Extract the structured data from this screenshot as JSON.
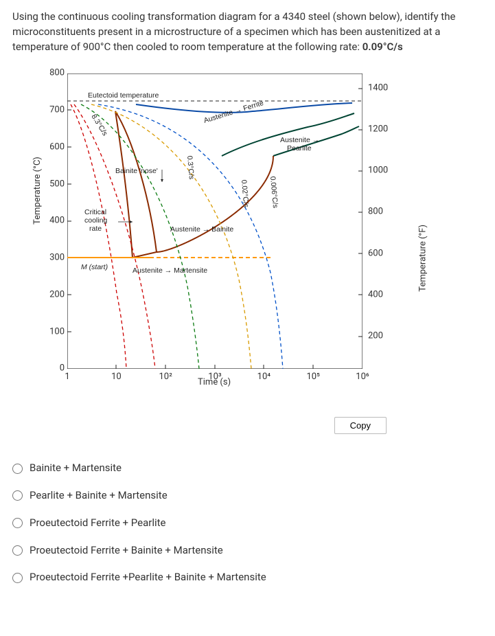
{
  "question": {
    "prefix": "Using the continuous cooling transformation diagram for a 4340 steel (shown below), identify the microconstituents present in a microstructure of a specimen which has been austenitized at a temperature of 900°C then cooled to room temperature at the following rate: ",
    "rate": "0.09°C/s"
  },
  "chart_data": {
    "type": "cct-diagram",
    "material": "4340 steel",
    "x_axis": {
      "label": "Time (s)",
      "scale": "log",
      "ticks": [
        "1",
        "10",
        "10²",
        "10³",
        "10⁴",
        "10⁵",
        "10⁶"
      ]
    },
    "y_axis_left": {
      "label": "Temperature (°C)",
      "min": 0,
      "max": 800,
      "ticks": [
        0,
        100,
        200,
        300,
        400,
        500,
        600,
        700,
        800
      ]
    },
    "y_axis_right": {
      "label": "Temperature (°F)",
      "ticks": [
        200,
        400,
        600,
        800,
        1000,
        1200,
        1400
      ]
    },
    "eutectoid_line": {
      "temp_c": 727,
      "label": "Eutectoid temperature"
    },
    "m_start": {
      "temp_c": 300,
      "label": "M (start)"
    },
    "annotations": {
      "critical_cooling_rate": "Critical cooling rate",
      "bainite_nose": "Bainite 'nose'",
      "austenite_ferrite": "Austenite → Ferrite",
      "austenite_pearlite": "Austenite → Pearlite",
      "austenite_bainite": "Austenite → Bainite",
      "austenite_martensite": "Austenite → Martensite"
    },
    "cooling_curves": [
      {
        "rate_c_per_s": 8.3,
        "label": "8.3°C/s"
      },
      {
        "rate_c_per_s": 0.3,
        "label": "0.3°C/s"
      },
      {
        "rate_c_per_s": 0.02,
        "label": "0.02°C/s"
      },
      {
        "rate_c_per_s": 0.006,
        "label": "0.006°C/s"
      }
    ]
  },
  "copy_button": "Copy",
  "options": [
    "Bainite + Martensite",
    "Pearlite + Bainite + Martensite",
    "Proeutectoid Ferrite + Pearlite",
    "Proeutectoid Ferrite + Bainite + Martensite",
    "Proeutectoid Ferrite +Pearlite + Bainite + Martensite"
  ]
}
